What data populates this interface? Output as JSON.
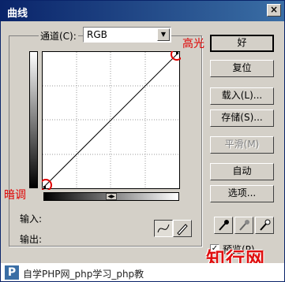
{
  "window": {
    "title": "曲线",
    "close_label": "×"
  },
  "channel": {
    "label": "通道(C):",
    "value": "RGB"
  },
  "buttons": {
    "ok": "好",
    "reset": "复位",
    "load": "载入(L)...",
    "save": "存储(S)...",
    "smooth": "平滑(M)",
    "auto": "自动",
    "options": "选项..."
  },
  "io": {
    "input_label": "输入:",
    "output_label": "输出:"
  },
  "preview": {
    "label": "预览(P)",
    "checked": true,
    "check_mark": "✓"
  },
  "annotations": {
    "highlight": "高光",
    "shadow": "暗调"
  },
  "watermark": {
    "big": "知行网",
    "logo": "P",
    "line": "自学PHP网_php学习_php教"
  },
  "colors": {
    "title_bar": "#0a246a",
    "annotation": "#e00000"
  }
}
